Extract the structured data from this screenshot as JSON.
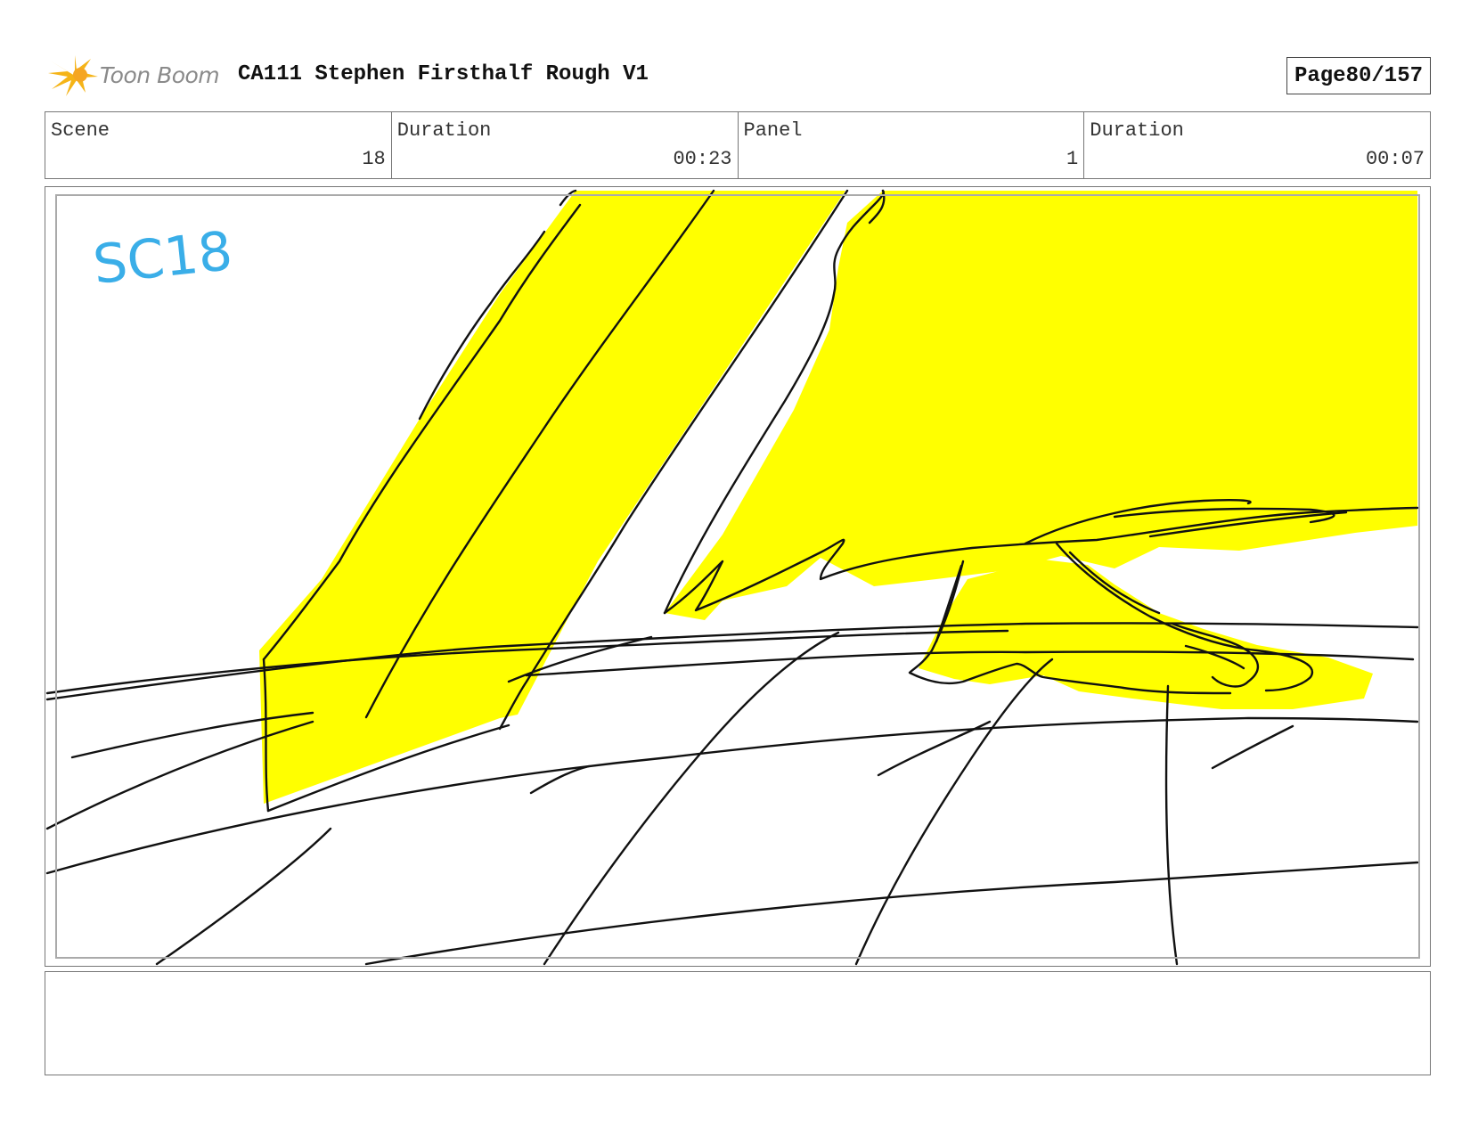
{
  "header": {
    "logo_text": "Toon Boom",
    "title": "CA111 Stephen Firsthalf Rough V1",
    "page_label": "Page",
    "page_value": "80/157"
  },
  "info": [
    {
      "label": "Scene",
      "value": "18"
    },
    {
      "label": "Duration",
      "value": "00:23"
    },
    {
      "label": "Panel",
      "value": "1"
    },
    {
      "label": "Duration",
      "value": "00:07"
    }
  ],
  "panel": {
    "scene_mark": "SC18"
  },
  "colors": {
    "fill_yellow": "#ffff00",
    "ink": "#111111",
    "scene_mark": "#3aaee8",
    "logo_orange": "#f5a623"
  }
}
